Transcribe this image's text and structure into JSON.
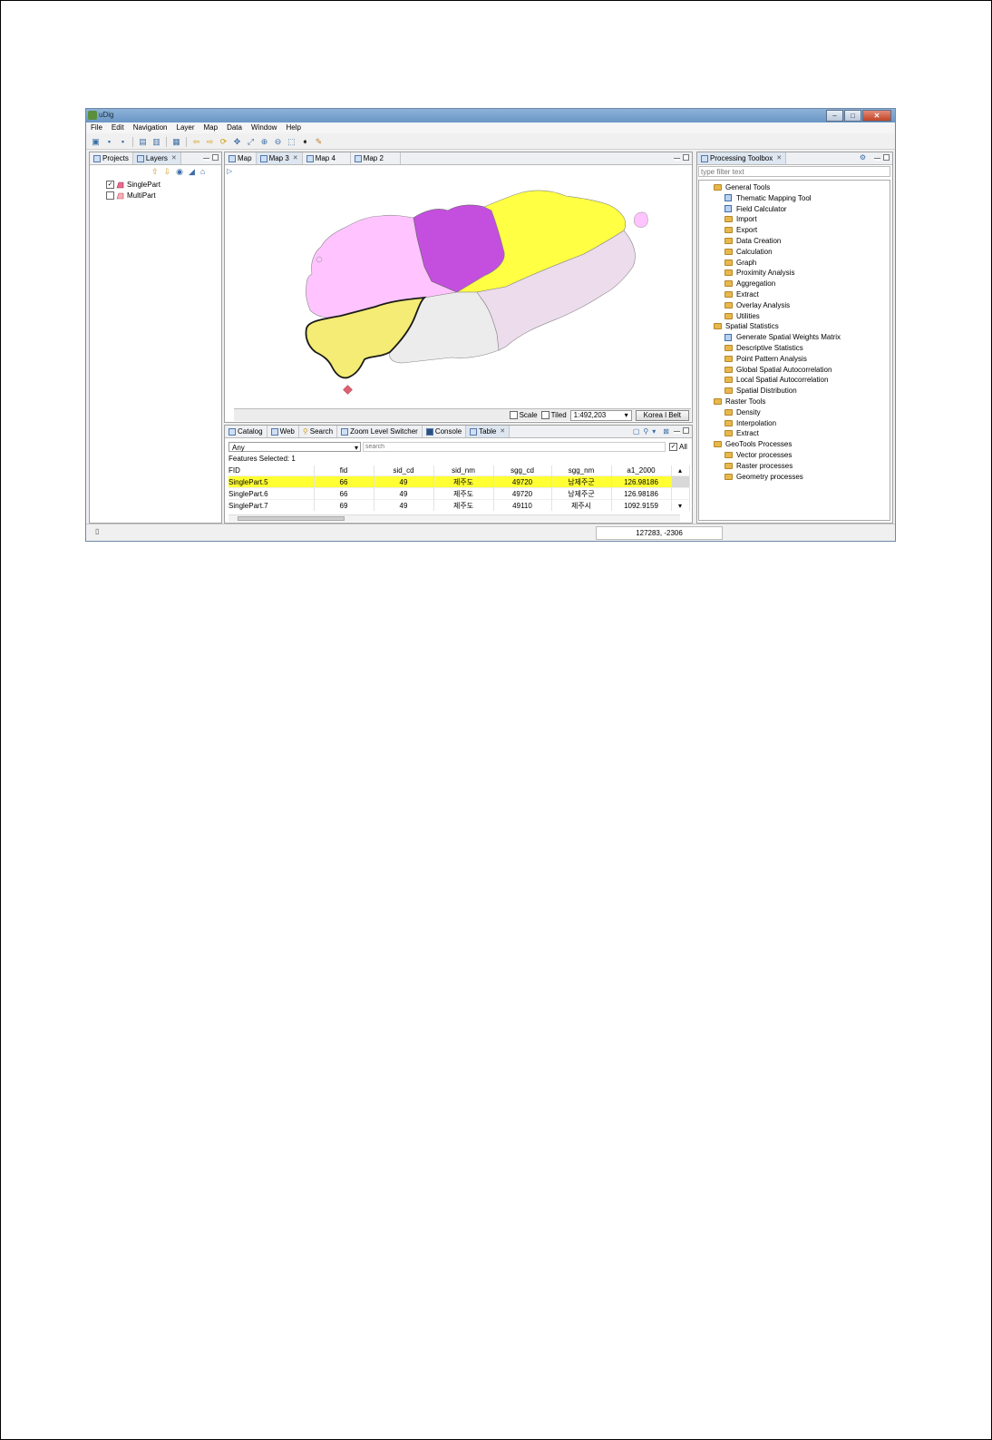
{
  "window": {
    "title": "uDig",
    "min": "–",
    "max": "□",
    "close": "✕"
  },
  "menu": [
    "File",
    "Edit",
    "Navigation",
    "Layer",
    "Map",
    "Data",
    "Window",
    "Help"
  ],
  "toolbar_icons": [
    "new-icon",
    "save-icon",
    "save-all-icon",
    "import-icon",
    "export-icon",
    "print-icon",
    "back-icon",
    "forward-icon",
    "refresh-icon",
    "pan-icon",
    "zoom-extent-icon",
    "zoom-in-icon",
    "zoom-out-icon",
    "select-icon",
    "info-icon",
    "edit-icon"
  ],
  "left_panel": {
    "tabs": [
      "Projects",
      "Layers"
    ],
    "layers": [
      {
        "name": "SinglePart",
        "checked": true,
        "color": "#e86a8e"
      },
      {
        "name": "MultiPart",
        "checked": false,
        "color": "#c24a5a"
      }
    ]
  },
  "map_editor": {
    "tabs": [
      "Map",
      "Map 3",
      "Map 4",
      "Map 2"
    ],
    "active_tab": "Map 3",
    "scale_label": "Scale",
    "tiled_label": "Tiled",
    "scale_value": "1:492,203",
    "crs_button": "Korea   l Belt",
    "region_colors": {
      "west": "#ffc4ff",
      "center_north": "#c44fde",
      "northeast": "#ffff44",
      "east": "#ecdcec",
      "south_center": "#ececec",
      "southwest_selected": "#f4ec74",
      "islet": "#e06070"
    }
  },
  "bottom_panel": {
    "tabs": [
      "Catalog",
      "Web",
      "Search",
      "Zoom Level Switcher",
      "Console",
      "Table"
    ],
    "active_tab": "Table",
    "filter_value": "Any",
    "search_placeholder": "search",
    "all_label": "All",
    "features_selected": "Features Selected: 1",
    "columns": [
      "FID",
      "fid",
      "sid_cd",
      "sid_nm",
      "sgg_cd",
      "sgg_nm",
      "a1_2000"
    ],
    "rows": [
      [
        "SinglePart.5",
        "66",
        "49",
        "제주도",
        "49720",
        "남제주군",
        "126.98186"
      ],
      [
        "SinglePart.6",
        "66",
        "49",
        "제주도",
        "49720",
        "남제주군",
        "126.98186"
      ],
      [
        "SinglePart.7",
        "69",
        "49",
        "제주도",
        "49110",
        "제주시",
        "1092.9159"
      ]
    ],
    "selected_row": 0
  },
  "toolbox": {
    "title": "Processing Toolbox",
    "filter_placeholder": "type filter text",
    "tree": [
      {
        "label": "General Tools",
        "level": 0,
        "kind": "folder"
      },
      {
        "label": "Thematic Mapping Tool",
        "level": 1,
        "kind": "tool"
      },
      {
        "label": "Field Calculator",
        "level": 1,
        "kind": "tool"
      },
      {
        "label": "Import",
        "level": 1,
        "kind": "folder"
      },
      {
        "label": "Export",
        "level": 1,
        "kind": "folder"
      },
      {
        "label": "Data Creation",
        "level": 1,
        "kind": "folder"
      },
      {
        "label": "Calculation",
        "level": 1,
        "kind": "folder"
      },
      {
        "label": "Graph",
        "level": 1,
        "kind": "folder"
      },
      {
        "label": "Proximity Analysis",
        "level": 1,
        "kind": "folder"
      },
      {
        "label": "Aggregation",
        "level": 1,
        "kind": "folder"
      },
      {
        "label": "Extract",
        "level": 1,
        "kind": "folder"
      },
      {
        "label": "Overlay Analysis",
        "level": 1,
        "kind": "folder"
      },
      {
        "label": "Utilities",
        "level": 1,
        "kind": "folder"
      },
      {
        "label": "Spatial Statistics",
        "level": 0,
        "kind": "folder"
      },
      {
        "label": "Generate Spatial Weights Matrix",
        "level": 1,
        "kind": "tool"
      },
      {
        "label": "Descriptive Statistics",
        "level": 1,
        "kind": "folder"
      },
      {
        "label": "Point Pattern Analysis",
        "level": 1,
        "kind": "folder"
      },
      {
        "label": "Global Spatial Autocorrelation",
        "level": 1,
        "kind": "folder"
      },
      {
        "label": "Local Spatial Autocorrelation",
        "level": 1,
        "kind": "folder"
      },
      {
        "label": "Spatial Distribution",
        "level": 1,
        "kind": "folder"
      },
      {
        "label": "Raster Tools",
        "level": 0,
        "kind": "folder"
      },
      {
        "label": "Density",
        "level": 1,
        "kind": "folder"
      },
      {
        "label": "Interpolation",
        "level": 1,
        "kind": "folder"
      },
      {
        "label": "Extract",
        "level": 1,
        "kind": "folder"
      },
      {
        "label": "GeoTools Processes",
        "level": 0,
        "kind": "folder"
      },
      {
        "label": "Vector processes",
        "level": 1,
        "kind": "folder"
      },
      {
        "label": "Raster processes",
        "level": 1,
        "kind": "folder"
      },
      {
        "label": "Geometry processes",
        "level": 1,
        "kind": "folder"
      }
    ]
  },
  "statusbar": {
    "coordinates": "127283, -2306"
  }
}
